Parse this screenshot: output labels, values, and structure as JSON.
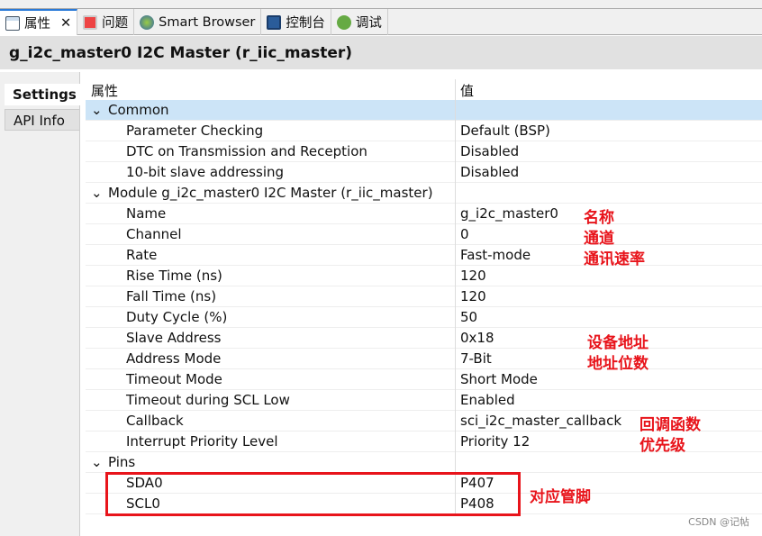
{
  "tabs": [
    {
      "label": "属性",
      "icon": "properties-icon",
      "active": true
    },
    {
      "label": "问题",
      "icon": "problems-icon"
    },
    {
      "label": "Smart Browser",
      "icon": "globe-icon"
    },
    {
      "label": "控制台",
      "icon": "console-icon"
    },
    {
      "label": "调试",
      "icon": "debug-icon"
    }
  ],
  "title": "g_i2c_master0 I2C Master (r_iic_master)",
  "side_tabs": [
    "Settings",
    "API Info"
  ],
  "columns": {
    "property": "属性",
    "value": "值"
  },
  "rows": [
    {
      "k": "Common",
      "v": "",
      "group": true
    },
    {
      "k": "Parameter Checking",
      "v": "Default (BSP)"
    },
    {
      "k": "DTC on Transmission and Reception",
      "v": "Disabled"
    },
    {
      "k": "10-bit slave addressing",
      "v": "Disabled"
    },
    {
      "k": "Module g_i2c_master0 I2C Master (r_iic_master)",
      "v": "",
      "group": true
    },
    {
      "k": "Name",
      "v": "g_i2c_master0"
    },
    {
      "k": "Channel",
      "v": "0"
    },
    {
      "k": "Rate",
      "v": "Fast-mode"
    },
    {
      "k": "Rise Time (ns)",
      "v": "120"
    },
    {
      "k": "Fall Time (ns)",
      "v": "120"
    },
    {
      "k": "Duty Cycle (%)",
      "v": "50"
    },
    {
      "k": "Slave Address",
      "v": "0x18"
    },
    {
      "k": "Address Mode",
      "v": "7-Bit"
    },
    {
      "k": "Timeout Mode",
      "v": "Short Mode"
    },
    {
      "k": "Timeout during SCL Low",
      "v": "Enabled"
    },
    {
      "k": "Callback",
      "v": "sci_i2c_master_callback"
    },
    {
      "k": "Interrupt Priority Level",
      "v": "Priority 12"
    },
    {
      "k": "Pins",
      "v": "",
      "group": true
    },
    {
      "k": "SDA0",
      "v": "P407"
    },
    {
      "k": "SCL0",
      "v": "P408"
    }
  ],
  "annotations": [
    "名称",
    "通道",
    "通讯速率",
    "设备地址",
    "地址位数",
    "回调函数",
    "优先级",
    "对应管脚"
  ],
  "watermark": "CSDN @记帖"
}
